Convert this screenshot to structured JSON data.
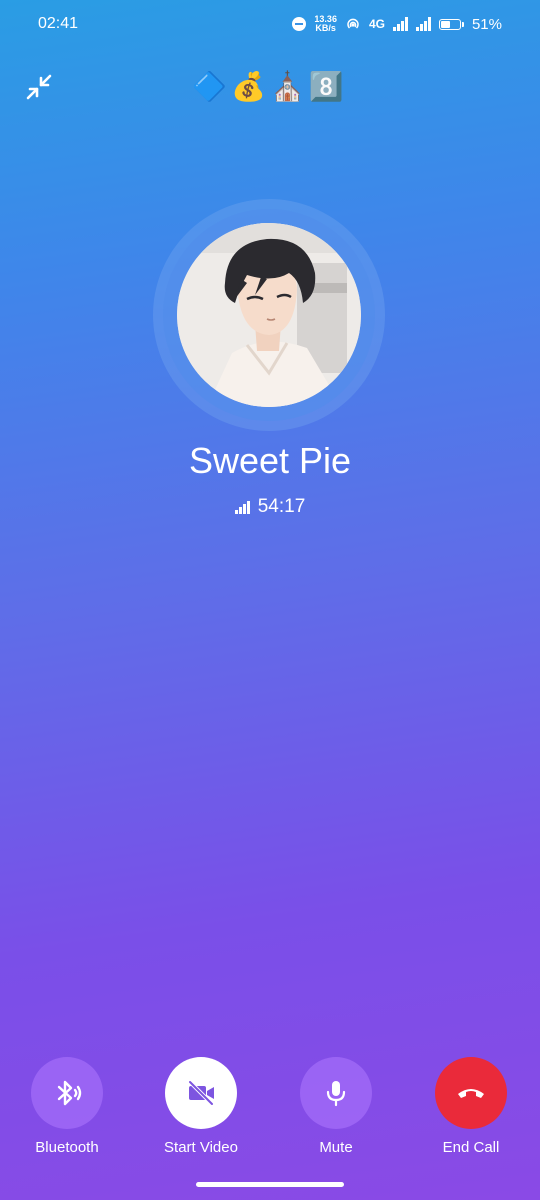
{
  "status_bar": {
    "time": "02:41",
    "net_speed_value": "13.36",
    "net_speed_unit": "KB/s",
    "network_type": "4G",
    "battery_percent": "51%",
    "battery_level": 0.51
  },
  "header": {
    "emoji_title": "🔷💰⛪8️⃣",
    "minimize_icon": "minimize-arrows-icon"
  },
  "call": {
    "caller_name": "Sweet Pie",
    "duration": "54:17",
    "signal_icon": "signal-bars-icon"
  },
  "controls": {
    "bluetooth_label": "Bluetooth",
    "start_video_label": "Start Video",
    "mute_label": "Mute",
    "end_call_label": "End Call"
  },
  "colors": {
    "end_call_red": "#ea2a3a",
    "gradient_top": "#2a9de4",
    "gradient_bottom": "#8a4ae6"
  }
}
